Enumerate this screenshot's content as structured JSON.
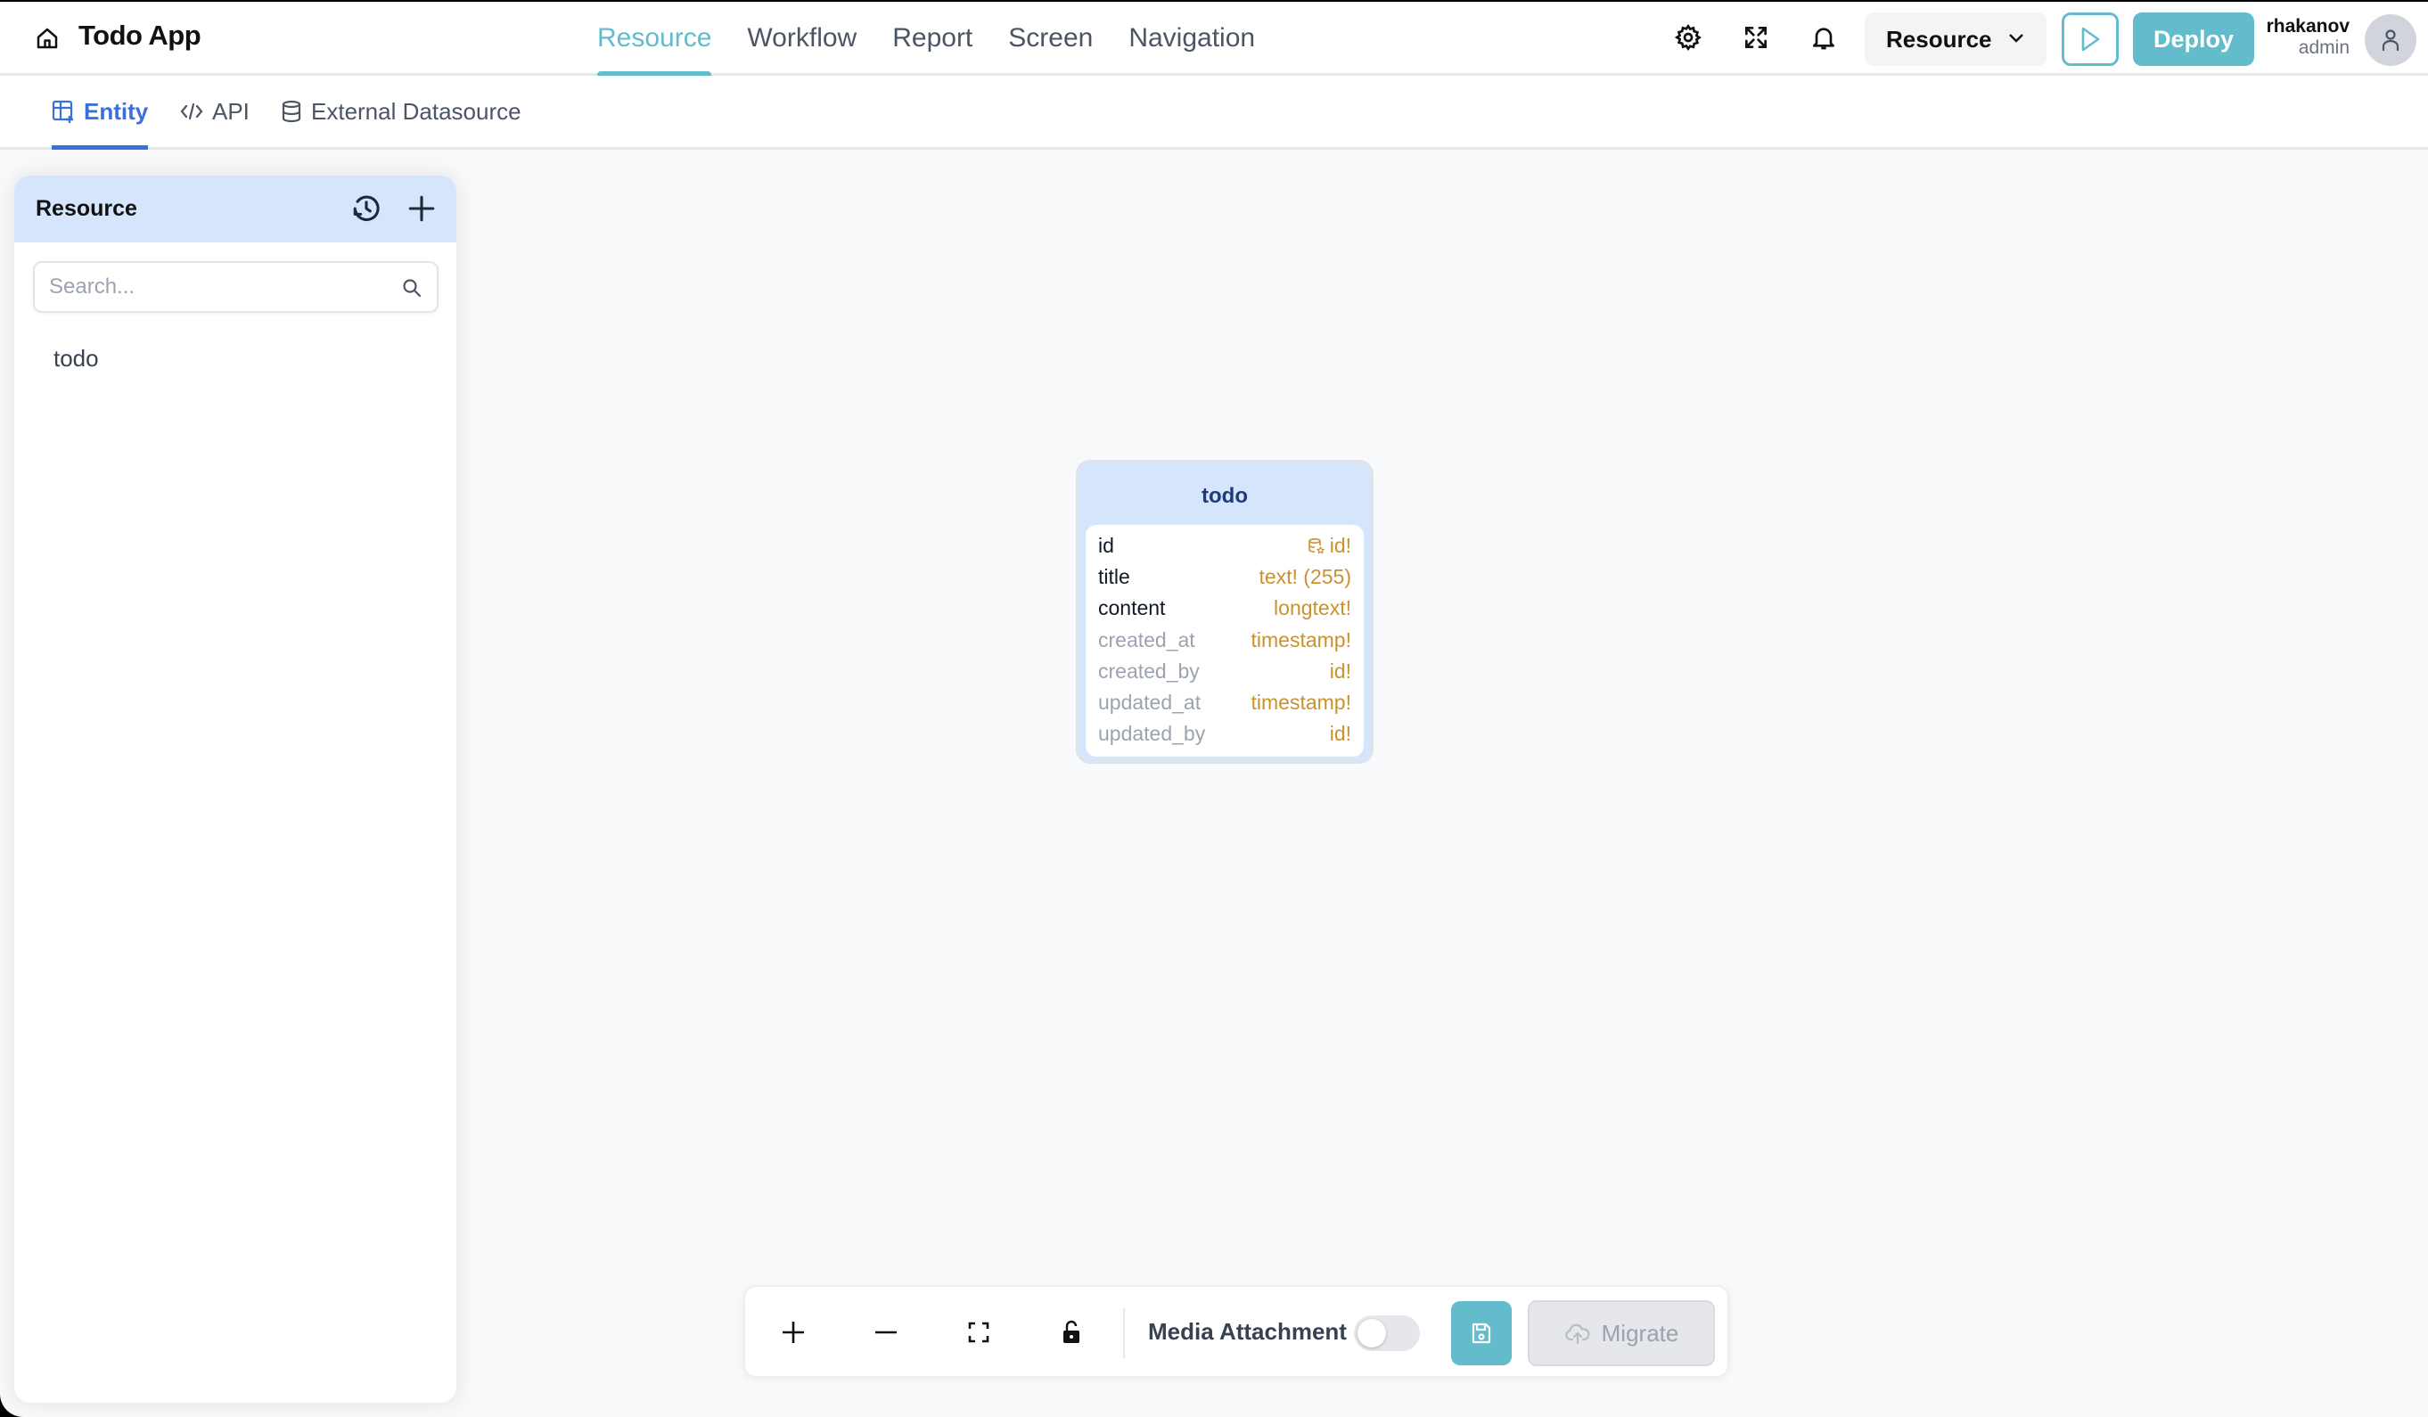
{
  "app": {
    "title": "Todo App"
  },
  "nav": {
    "items": [
      {
        "label": "Resource",
        "active": true
      },
      {
        "label": "Workflow",
        "active": false
      },
      {
        "label": "Report",
        "active": false
      },
      {
        "label": "Screen",
        "active": false
      },
      {
        "label": "Navigation",
        "active": false
      }
    ]
  },
  "header": {
    "icons": [
      "gear-icon",
      "expand-icon",
      "bell-icon"
    ],
    "resource_select": {
      "value": "Resource"
    },
    "run_label": "Run",
    "deploy_label": "Deploy",
    "user": {
      "name": "rhakanov",
      "role": "admin"
    }
  },
  "subtabs": [
    {
      "label": "Entity",
      "icon": "table-plus-icon",
      "active": true
    },
    {
      "label": "API",
      "icon": "code-icon",
      "active": false
    },
    {
      "label": "External Datasource",
      "icon": "database-icon",
      "active": false
    }
  ],
  "sidebar": {
    "title": "Resource",
    "search": {
      "placeholder": "Search...",
      "value": ""
    },
    "items": [
      {
        "label": "todo"
      }
    ]
  },
  "entity": {
    "name": "todo",
    "fields": [
      {
        "name": "id",
        "type": "id!",
        "primary_key": true,
        "system": false
      },
      {
        "name": "title",
        "type": "text! (255)",
        "primary_key": false,
        "system": false
      },
      {
        "name": "content",
        "type": "longtext!",
        "primary_key": false,
        "system": false
      },
      {
        "name": "created_at",
        "type": "timestamp!",
        "primary_key": false,
        "system": true
      },
      {
        "name": "created_by",
        "type": "id!",
        "primary_key": false,
        "system": true
      },
      {
        "name": "updated_at",
        "type": "timestamp!",
        "primary_key": false,
        "system": true
      },
      {
        "name": "updated_by",
        "type": "id!",
        "primary_key": false,
        "system": true
      }
    ]
  },
  "toolbar": {
    "media_attachment_label": "Media Attachment",
    "media_attachment_enabled": false,
    "migrate_label": "Migrate",
    "migrate_enabled": false
  },
  "colors": {
    "accent": "#62bccb",
    "tab_active": "#3b6fd9",
    "entity_header": "#d5e6fc",
    "field_type": "#c9922f"
  }
}
